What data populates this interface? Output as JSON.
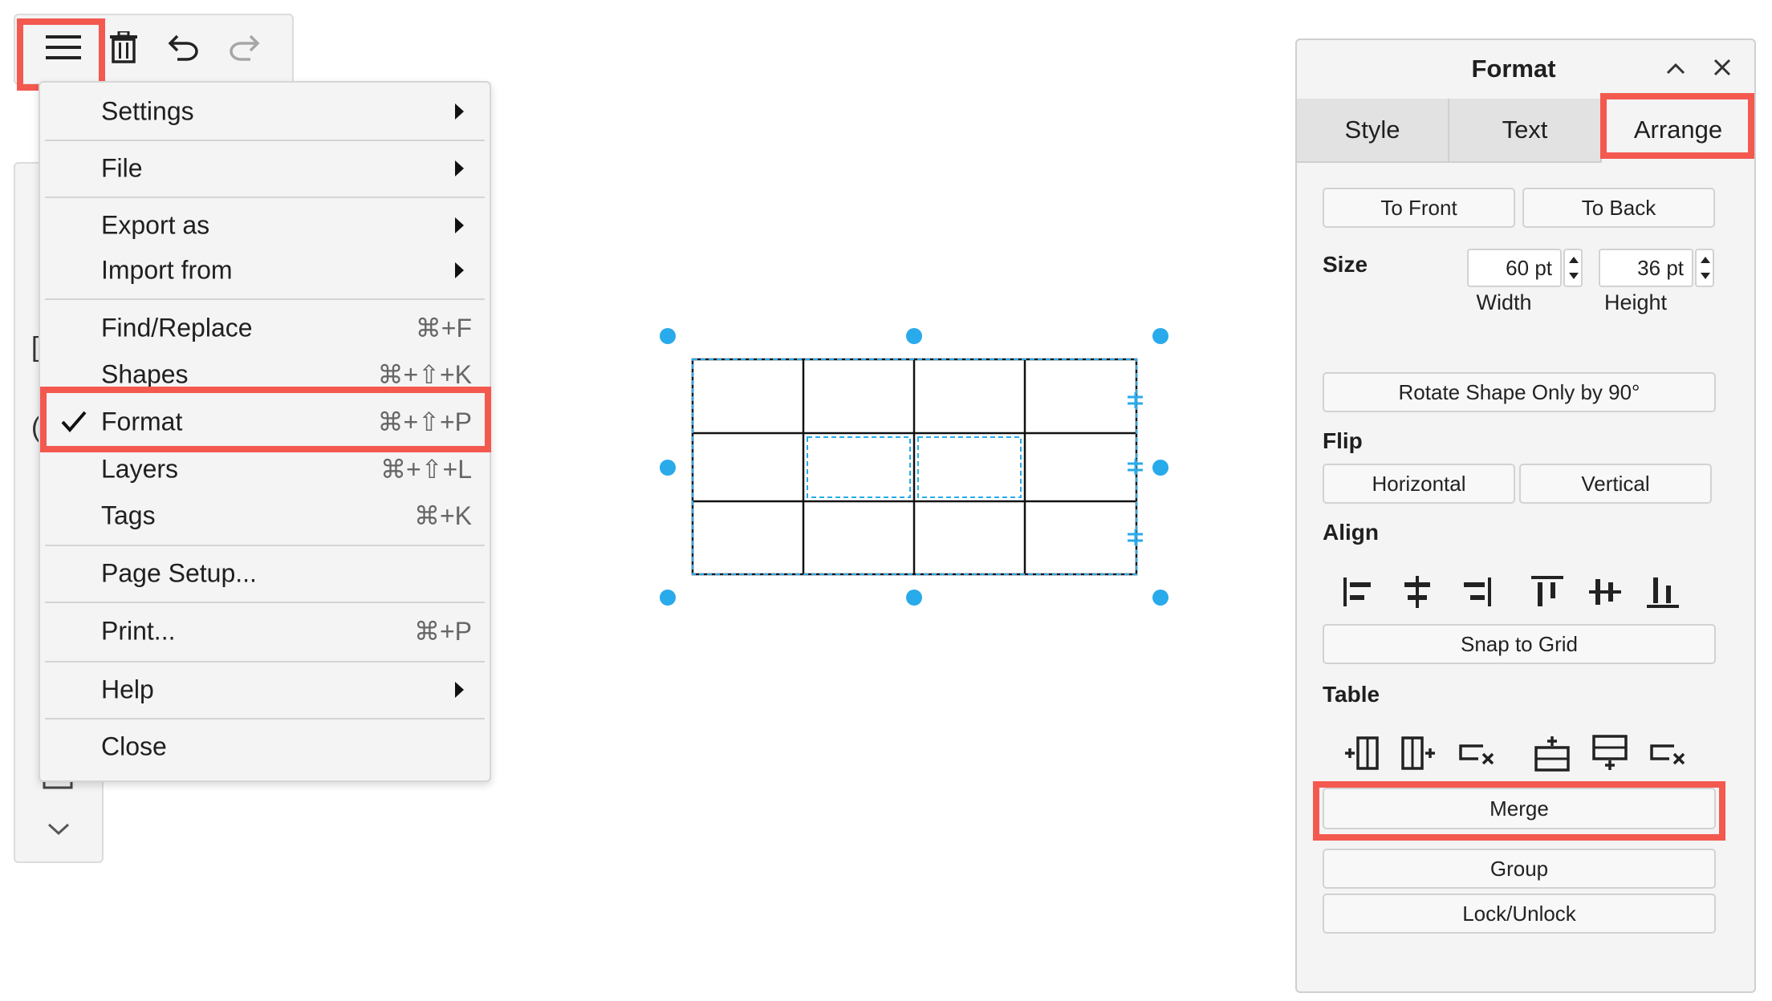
{
  "toolbar": {
    "icons": [
      "menu-icon",
      "trash-icon",
      "undo-icon",
      "redo-icon"
    ]
  },
  "menu": {
    "items": [
      {
        "label": "Settings",
        "shortcut": "",
        "submenu": true
      },
      {
        "label": "File",
        "shortcut": "",
        "submenu": true
      },
      {
        "label": "Export as",
        "shortcut": "",
        "submenu": true
      },
      {
        "label": "Import from",
        "shortcut": "",
        "submenu": true
      },
      {
        "label": "Find/Replace",
        "shortcut": "⌘+F",
        "submenu": false
      },
      {
        "label": "Shapes",
        "shortcut": "⌘+⇧+K",
        "submenu": false
      },
      {
        "label": "Format",
        "shortcut": "⌘+⇧+P",
        "submenu": false,
        "checked": true
      },
      {
        "label": "Layers",
        "shortcut": "⌘+⇧+L",
        "submenu": false
      },
      {
        "label": "Tags",
        "shortcut": "⌘+K",
        "submenu": false
      },
      {
        "label": "Page Setup...",
        "shortcut": "",
        "submenu": false
      },
      {
        "label": "Print...",
        "shortcut": "⌘+P",
        "submenu": false
      },
      {
        "label": "Help",
        "shortcut": "",
        "submenu": true
      },
      {
        "label": "Close",
        "shortcut": "",
        "submenu": false
      }
    ]
  },
  "format_panel": {
    "title": "Format",
    "tabs": [
      "Style",
      "Text",
      "Arrange"
    ],
    "active_tab": "Arrange",
    "to_front": "To Front",
    "to_back": "To Back",
    "size_label": "Size",
    "width_value": "60 pt",
    "height_value": "36 pt",
    "width_label": "Width",
    "height_label": "Height",
    "rotate": "Rotate Shape Only by 90°",
    "flip_label": "Flip",
    "flip_horizontal": "Horizontal",
    "flip_vertical": "Vertical",
    "align_label": "Align",
    "align_icons": [
      "align-left-icon",
      "align-center-icon",
      "align-right-icon",
      "align-top-icon",
      "align-middle-icon",
      "align-bottom-icon"
    ],
    "snap_to_grid": "Snap to Grid",
    "table_label": "Table",
    "table_icons": [
      "insert-column-before-icon",
      "insert-column-after-icon",
      "delete-column-icon",
      "insert-row-before-icon",
      "insert-row-after-icon",
      "delete-row-icon"
    ],
    "merge": "Merge",
    "group": "Group",
    "lock_unlock": "Lock/Unlock"
  },
  "colors": {
    "highlight": "#f4594f",
    "selection": "#29aaeb",
    "panel_bg": "#f4f4f4"
  }
}
